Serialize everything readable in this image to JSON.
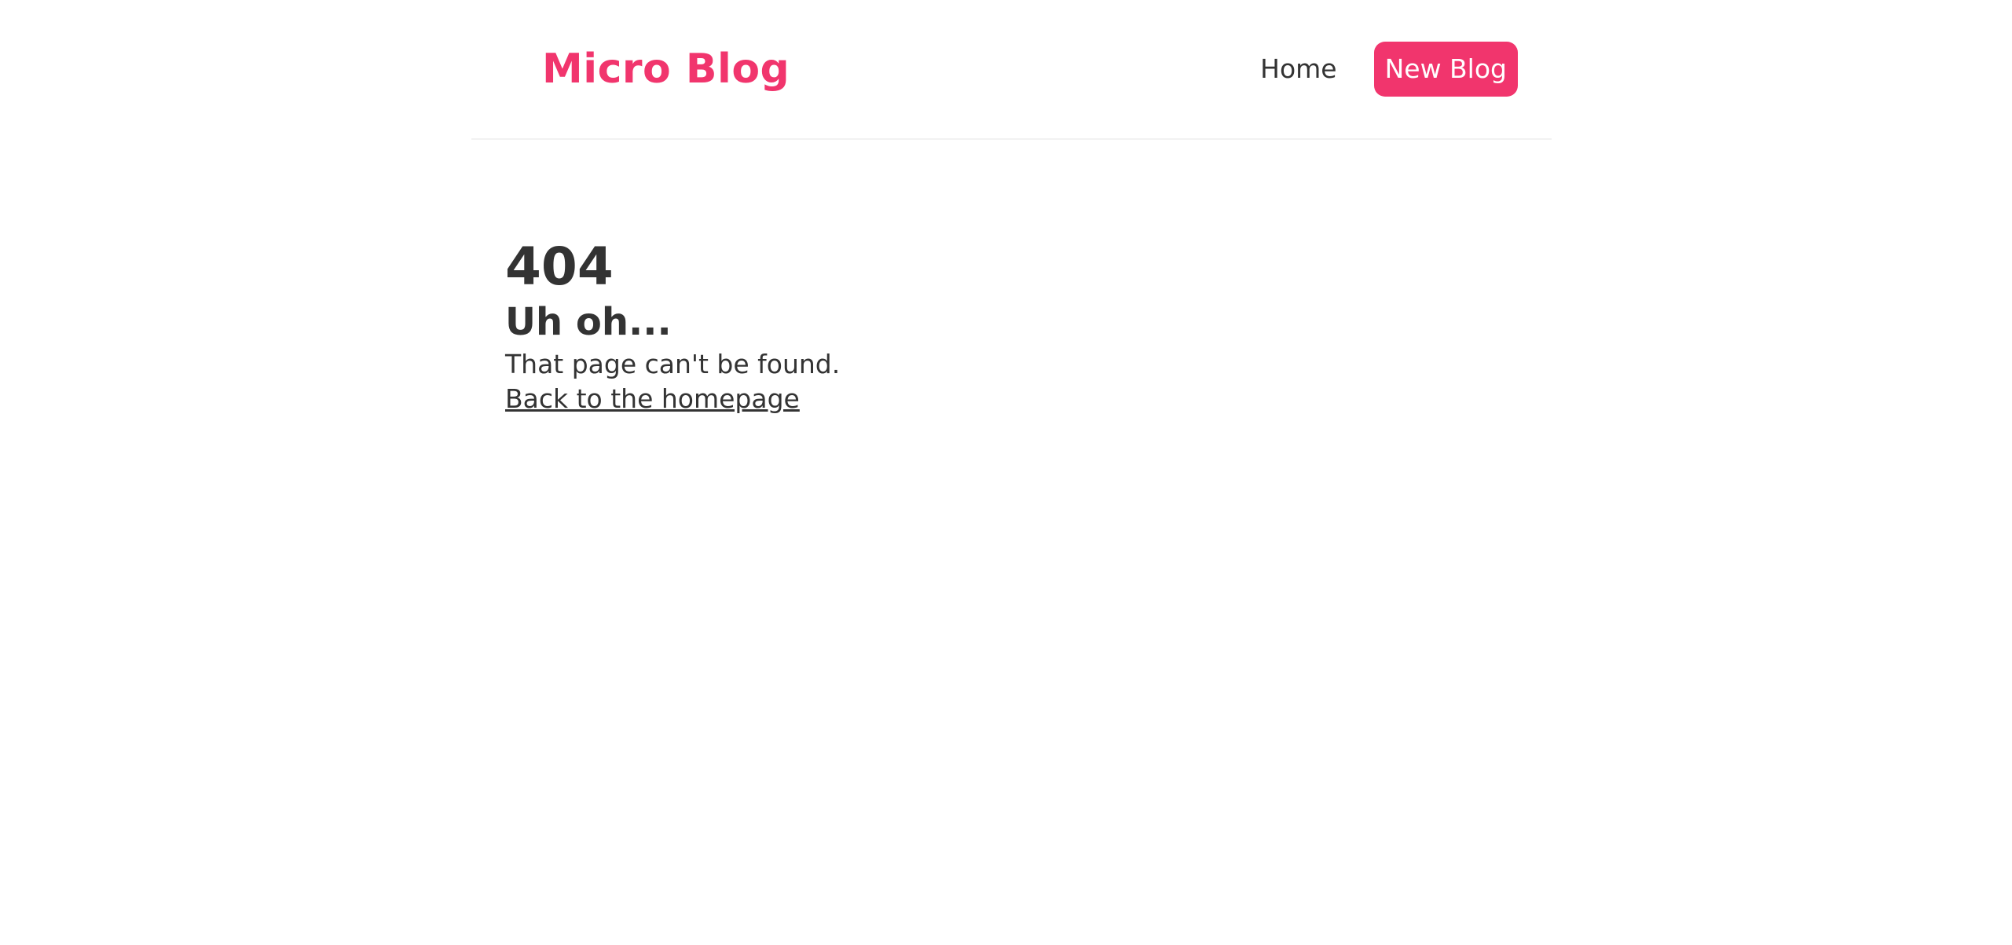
{
  "header": {
    "brand": "Micro Blog",
    "nav": {
      "home_label": "Home",
      "new_blog_label": "New Blog"
    }
  },
  "not_found": {
    "code": "404",
    "heading": "Uh oh...",
    "message": "That page can't be found.",
    "back_link_label": "Back to the homepage"
  },
  "colors": {
    "accent": "#f1356d",
    "text": "#333333",
    "divider": "#f2f2f2",
    "background": "#ffffff"
  }
}
